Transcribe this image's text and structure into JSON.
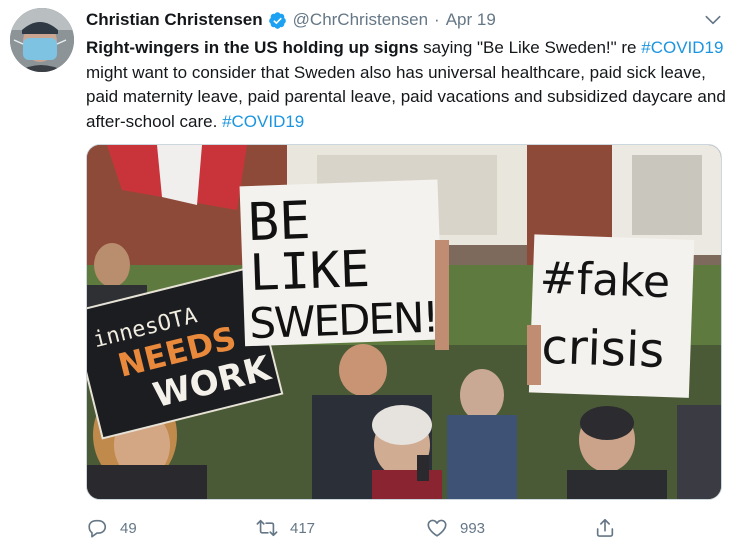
{
  "author": {
    "display_name": "Christian Christensen",
    "handle": "@ChrChristensen",
    "separator": "·",
    "timestamp": "Apr 19",
    "verified": true
  },
  "tweet": {
    "bold_lead": "Right-wingers in the US holding up signs",
    "text_part1": " saying \"Be Like Sweden!\" re ",
    "hashtag1": "#COVID19",
    "text_part2": " might want to consider that Sweden also has universal healthcare, paid sick leave, paid maternity leave, paid parental leave, paid vacations and subsidized daycare and after-school care. ",
    "hashtag2": "#COVID19"
  },
  "photo": {
    "sign_left_line1": "innesOTA",
    "sign_left_line2": "NEEDS",
    "sign_left_line3": "WORK",
    "sign_center_line1": "BE",
    "sign_center_line2": "LIKE",
    "sign_center_line3": "SWEDEN!",
    "sign_right_line1": "#fake",
    "sign_right_line2": "crisis"
  },
  "actions": {
    "reply_count": "49",
    "retweet_count": "417",
    "like_count": "993"
  },
  "colors": {
    "link": "#1b95e0",
    "muted": "#657786",
    "verified": "#1da1f2"
  },
  "icons": {
    "verified": "verified-badge-icon",
    "caret": "chevron-down-icon",
    "reply": "reply-icon",
    "retweet": "retweet-icon",
    "like": "heart-icon",
    "share": "share-icon"
  }
}
